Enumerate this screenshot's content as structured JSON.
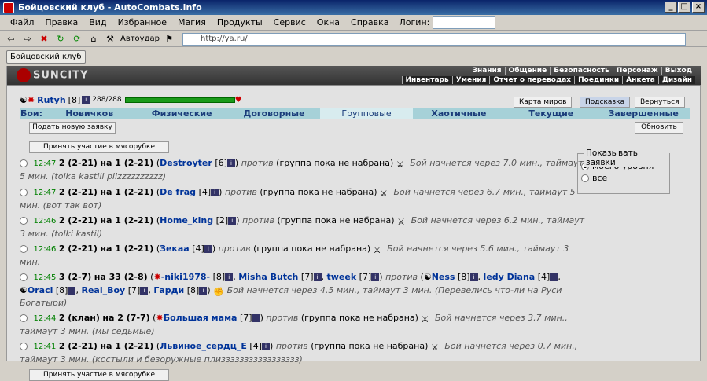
{
  "window": {
    "title": "Бойцовский клуб - AutoCombats.info"
  },
  "menu": [
    "Файл",
    "Правка",
    "Вид",
    "Избранное",
    "Магия",
    "Продукты",
    "Сервис",
    "Окна",
    "Справка"
  ],
  "login_label": "Логин:",
  "toolbar": {
    "autoudar": "Автоудар",
    "address": "http://ya.ru/"
  },
  "tab": {
    "label": "Бойцовский клуб"
  },
  "logo": "SUNCITY",
  "nav_top": [
    "Знания",
    "Общение",
    "Безопасность",
    "Персонаж",
    "Выход"
  ],
  "nav_bottom": [
    "Инвентарь",
    "Умения",
    "Отчет о переводах",
    "Поединки",
    "Анкета",
    "Дизайн"
  ],
  "user": {
    "name": "Rutyh",
    "level": "[8]",
    "hp": "288/288"
  },
  "buttons": {
    "map": "Карта миров",
    "hint": "Подсказка",
    "back": "Вернуться",
    "new_request": "Подать новую заявку",
    "refresh": "Обновить",
    "join_top": "Принять участие в мясорубке",
    "join_bottom": "Принять участие в мясорубке"
  },
  "fights_label": "Бои:",
  "battle_tabs": [
    "Новичков",
    "Физические",
    "Договорные",
    "Групповые",
    "Хаотичные",
    "Текущие",
    "Завершенные"
  ],
  "show": {
    "title": "Показывать заявки",
    "opt1": "моего уровня",
    "opt2": "все"
  },
  "requests": [
    {
      "time": "12:47",
      "a": "2 (2-21)",
      "b": "на 1 (2-21)",
      "players": "Destroyter",
      "plev": "[6]",
      "vs": "против",
      "vs2": "(группа пока не набрана)",
      "info": "Бой начнется через 7.0 мин., таймаут 5 мин. (tolka kastili plizzzzzzzzzz)"
    },
    {
      "time": "12:47",
      "a": "2 (2-21)",
      "b": "на 1 (2-21)",
      "players": "De frag",
      "plev": "[4]",
      "vs": "против",
      "vs2": "(группа пока не набрана)",
      "info": "Бой начнется через 6.7 мин., таймаут 5 мин. (вот так вот)"
    },
    {
      "time": "12:46",
      "a": "2 (2-21)",
      "b": "на 1 (2-21)",
      "players": "Home_king",
      "plev": "[2]",
      "vs": "против",
      "vs2": "(группа пока не набрана)",
      "info": "Бой начнется через 6.2 мин., таймаут 3 мин. (tolki kastil)"
    },
    {
      "time": "12:46",
      "a": "2 (2-21)",
      "b": "на 1 (2-21)",
      "players": "Зекаа",
      "plev": "[4]",
      "vs": "против",
      "vs2": "(группа пока не набрана)",
      "info": "Бой начнется через 5.6 мин., таймаут 3 мин."
    },
    {
      "time": "12:45",
      "a": "3 (2-7)",
      "b": "на 33 (2-8)",
      "players": "-niki1978-",
      "plev": "[8]",
      "p2": "Misha Butch",
      "p2lev": "[7]",
      "p3": "tweek",
      "p3lev": "[7]",
      "vs": "против",
      "o1": "Ness",
      "o1lev": "[8]",
      "o2": "ledy Diana",
      "o2lev": "[4]",
      "o3": "Oracl",
      "o3lev": "[8]",
      "o4": "Real_Boy",
      "o4lev": "[7]",
      "o5": "Гарди",
      "o5lev": "[8]",
      "info": "Бой начнется через 4.5 мин., таймаут 3 мин. (Перевелись что-ли на Руси Богатыри)"
    },
    {
      "time": "12:44",
      "a": "2 (клан)",
      "b": "на 2 (7-7)",
      "players": "Большая мама",
      "plev": "[7]",
      "vs": "против",
      "vs2": "(группа пока не набрана)",
      "info": "Бой начнется через 3.7 мин., таймаут 3 мин. (мы седьмые)"
    },
    {
      "time": "12:41",
      "a": "2 (2-21)",
      "b": "на 1 (2-21)",
      "players": "Львиное_сердц_Е",
      "plev": "[4]",
      "vs": "против",
      "vs2": "(группа пока не набрана)",
      "info": "Бой начнется через 0.7 мин., таймаут 3 мин. (костыли и безоружные плиззззззззззззззззз)"
    }
  ]
}
